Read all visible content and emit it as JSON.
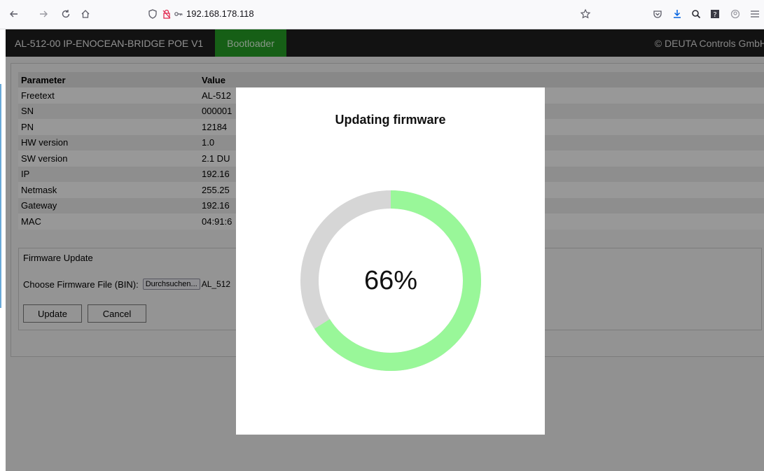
{
  "browser": {
    "url": "192.168.178.118",
    "icons": [
      "back-icon",
      "forward-icon",
      "reload-icon",
      "home-icon",
      "shield-icon",
      "lock-icon",
      "key-icon",
      "star-icon",
      "pocket-icon",
      "download-icon",
      "extension-icon",
      "help-icon",
      "account-icon",
      "menu-icon"
    ]
  },
  "header": {
    "title": "AL-512-00 IP-ENOCEAN-BRIDGE POE V1",
    "tab": "Bootloader",
    "copyright": "© DEUTA Controls GmbH"
  },
  "table": {
    "headers": [
      "Parameter",
      "Value"
    ],
    "rows": [
      {
        "param": "Freetext",
        "value": "AL-512"
      },
      {
        "param": "SN",
        "value": "000001"
      },
      {
        "param": "PN",
        "value": "12184"
      },
      {
        "param": "HW version",
        "value": "1.0"
      },
      {
        "param": "SW version",
        "value": "2.1 DU"
      },
      {
        "param": "IP",
        "value": "192.16"
      },
      {
        "param": "Netmask",
        "value": "255.25"
      },
      {
        "param": "Gateway",
        "value": "192.16"
      },
      {
        "param": "MAC",
        "value": "04:91:6"
      }
    ]
  },
  "firmware": {
    "title": "Firmware Update",
    "choose_label": "Choose Firmware File (BIN):",
    "browse_label": "Durchsuchen...",
    "file_name": "AL_512",
    "update_label": "Update",
    "cancel_label": "Cancel"
  },
  "modal": {
    "title": "Updating firmware",
    "progress": 0.66,
    "percent_text": "66%"
  },
  "colors": {
    "progress_fill": "#99f799",
    "progress_track": "#d6d6d6",
    "header_bg": "#1e1e1e",
    "tab_active": "#249a24"
  }
}
